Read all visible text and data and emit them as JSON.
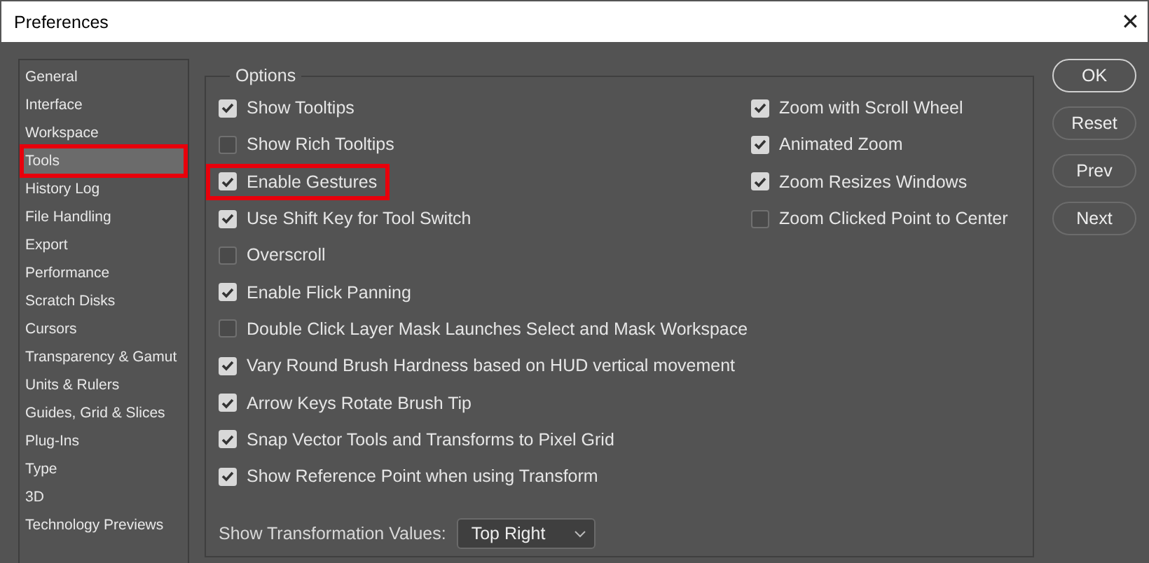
{
  "window": {
    "title": "Preferences",
    "close": "✕"
  },
  "sidebar": {
    "items": [
      {
        "label": "General",
        "selected": false,
        "highlighted": false
      },
      {
        "label": "Interface",
        "selected": false,
        "highlighted": false
      },
      {
        "label": "Workspace",
        "selected": false,
        "highlighted": false
      },
      {
        "label": "Tools",
        "selected": true,
        "highlighted": true
      },
      {
        "label": "History Log",
        "selected": false,
        "highlighted": false
      },
      {
        "label": "File Handling",
        "selected": false,
        "highlighted": false
      },
      {
        "label": "Export",
        "selected": false,
        "highlighted": false
      },
      {
        "label": "Performance",
        "selected": false,
        "highlighted": false
      },
      {
        "label": "Scratch Disks",
        "selected": false,
        "highlighted": false
      },
      {
        "label": "Cursors",
        "selected": false,
        "highlighted": false
      },
      {
        "label": "Transparency & Gamut",
        "selected": false,
        "highlighted": false
      },
      {
        "label": "Units & Rulers",
        "selected": false,
        "highlighted": false
      },
      {
        "label": "Guides, Grid & Slices",
        "selected": false,
        "highlighted": false
      },
      {
        "label": "Plug-Ins",
        "selected": false,
        "highlighted": false
      },
      {
        "label": "Type",
        "selected": false,
        "highlighted": false
      },
      {
        "label": "3D",
        "selected": false,
        "highlighted": false
      },
      {
        "label": "Technology Previews",
        "selected": false,
        "highlighted": false
      }
    ]
  },
  "options": {
    "title": "Options",
    "left": [
      {
        "label": "Show Tooltips",
        "checked": true,
        "highlighted": false
      },
      {
        "label": "Show Rich Tooltips",
        "checked": false,
        "highlighted": false
      },
      {
        "label": "Enable Gestures",
        "checked": true,
        "highlighted": true
      },
      {
        "label": "Use Shift Key for Tool Switch",
        "checked": true,
        "highlighted": false
      },
      {
        "label": "Overscroll",
        "checked": false,
        "highlighted": false
      },
      {
        "label": "Enable Flick Panning",
        "checked": true,
        "highlighted": false
      },
      {
        "label": "Double Click Layer Mask Launches Select and Mask Workspace",
        "checked": false,
        "highlighted": false
      },
      {
        "label": "Vary Round Brush Hardness based on HUD vertical movement",
        "checked": true,
        "highlighted": false
      },
      {
        "label": "Arrow Keys Rotate Brush Tip",
        "checked": true,
        "highlighted": false
      },
      {
        "label": "Snap Vector Tools and Transforms to Pixel Grid",
        "checked": true,
        "highlighted": false
      },
      {
        "label": "Show Reference Point when using Transform",
        "checked": true,
        "highlighted": false
      }
    ],
    "right": [
      {
        "label": "Zoom with Scroll Wheel",
        "checked": true,
        "highlighted": false
      },
      {
        "label": "Animated Zoom",
        "checked": true,
        "highlighted": false
      },
      {
        "label": "Zoom Resizes Windows",
        "checked": true,
        "highlighted": false
      },
      {
        "label": "Zoom Clicked Point to Center",
        "checked": false,
        "highlighted": false
      }
    ],
    "transformation_values": {
      "label": "Show Transformation Values:",
      "value": "Top Right"
    }
  },
  "buttons": [
    {
      "label": "OK",
      "default": true
    },
    {
      "label": "Reset",
      "default": false
    },
    {
      "label": "Prev",
      "default": false
    },
    {
      "label": "Next",
      "default": false
    }
  ]
}
